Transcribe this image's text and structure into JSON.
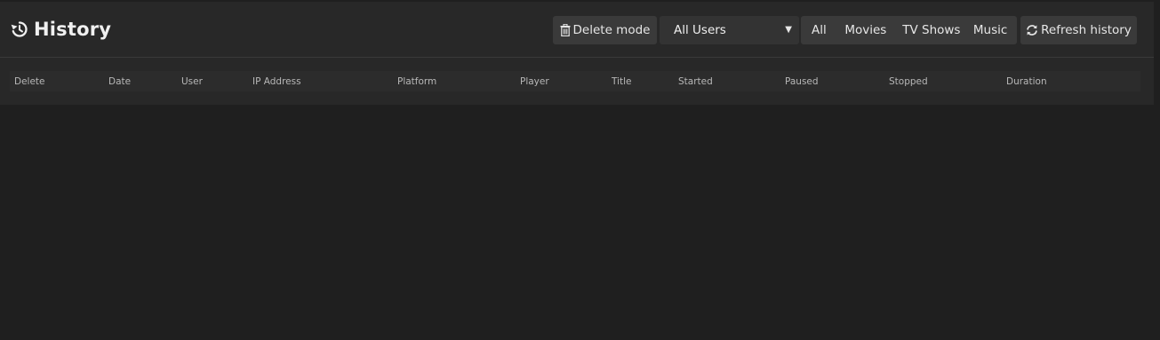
{
  "header": {
    "title": "History",
    "title_icon": "history-icon"
  },
  "toolbar": {
    "delete_mode_label": "Delete mode",
    "delete_icon": "trash-icon",
    "user_select_value": "All Users",
    "filter_tabs": [
      "All",
      "Movies",
      "TV Shows",
      "Music"
    ],
    "refresh_label": "Refresh history",
    "refresh_icon": "refresh-icon"
  },
  "table": {
    "columns": [
      "Delete",
      "Date",
      "User",
      "IP Address",
      "Platform",
      "Player",
      "Title",
      "Started",
      "Paused",
      "Stopped",
      "Duration"
    ]
  },
  "colors": {
    "background": "#1f1f1f",
    "panel": "#282828",
    "button": "#3a3a3a",
    "text": "#e6e6e6"
  }
}
